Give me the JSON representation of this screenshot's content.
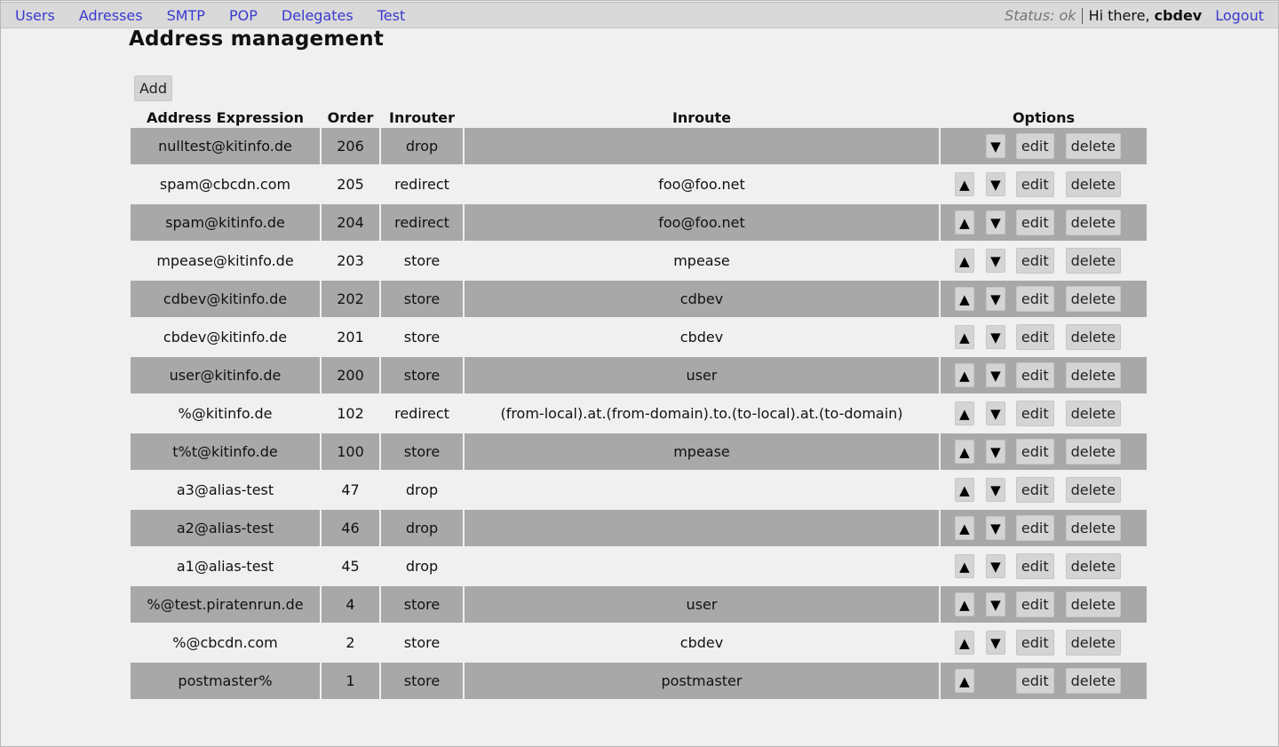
{
  "nav": {
    "items": [
      "Users",
      "Adresses",
      "SMTP",
      "POP",
      "Delegates",
      "Test"
    ]
  },
  "userbar": {
    "status": "Status: ok",
    "greeting": "Hi there,",
    "username": "cbdev",
    "logout": "Logout"
  },
  "page": {
    "title": "Address management",
    "add_label": "Add"
  },
  "table": {
    "headers": [
      "Address Expression",
      "Order",
      "Inrouter",
      "Inroute",
      "Options"
    ],
    "edit_label": "edit",
    "delete_label": "delete",
    "up_symbol": "▲",
    "down_symbol": "▼",
    "rows": [
      {
        "expr": "nulltest@kitinfo.de",
        "order": "206",
        "router": "drop",
        "route": "",
        "up": false,
        "down": true
      },
      {
        "expr": "spam@cbcdn.com",
        "order": "205",
        "router": "redirect",
        "route": "foo@foo.net",
        "up": true,
        "down": true
      },
      {
        "expr": "spam@kitinfo.de",
        "order": "204",
        "router": "redirect",
        "route": "foo@foo.net",
        "up": true,
        "down": true
      },
      {
        "expr": "mpease@kitinfo.de",
        "order": "203",
        "router": "store",
        "route": "mpease",
        "up": true,
        "down": true
      },
      {
        "expr": "cdbev@kitinfo.de",
        "order": "202",
        "router": "store",
        "route": "cdbev",
        "up": true,
        "down": true
      },
      {
        "expr": "cbdev@kitinfo.de",
        "order": "201",
        "router": "store",
        "route": "cbdev",
        "up": true,
        "down": true
      },
      {
        "expr": "user@kitinfo.de",
        "order": "200",
        "router": "store",
        "route": "user",
        "up": true,
        "down": true
      },
      {
        "expr": "%@kitinfo.de",
        "order": "102",
        "router": "redirect",
        "route": "(from-local).at.(from-domain).to.(to-local).at.(to-domain)",
        "up": true,
        "down": true
      },
      {
        "expr": "t%t@kitinfo.de",
        "order": "100",
        "router": "store",
        "route": "mpease",
        "up": true,
        "down": true
      },
      {
        "expr": "a3@alias-test",
        "order": "47",
        "router": "drop",
        "route": "",
        "up": true,
        "down": true
      },
      {
        "expr": "a2@alias-test",
        "order": "46",
        "router": "drop",
        "route": "",
        "up": true,
        "down": true
      },
      {
        "expr": "a1@alias-test",
        "order": "45",
        "router": "drop",
        "route": "",
        "up": true,
        "down": true
      },
      {
        "expr": "%@test.piratenrun.de",
        "order": "4",
        "router": "store",
        "route": "user",
        "up": true,
        "down": true
      },
      {
        "expr": "%@cbcdn.com",
        "order": "2",
        "router": "store",
        "route": "cbdev",
        "up": true,
        "down": true
      },
      {
        "expr": "postmaster%",
        "order": "1",
        "router": "store",
        "route": "postmaster",
        "up": true,
        "down": false
      }
    ]
  }
}
